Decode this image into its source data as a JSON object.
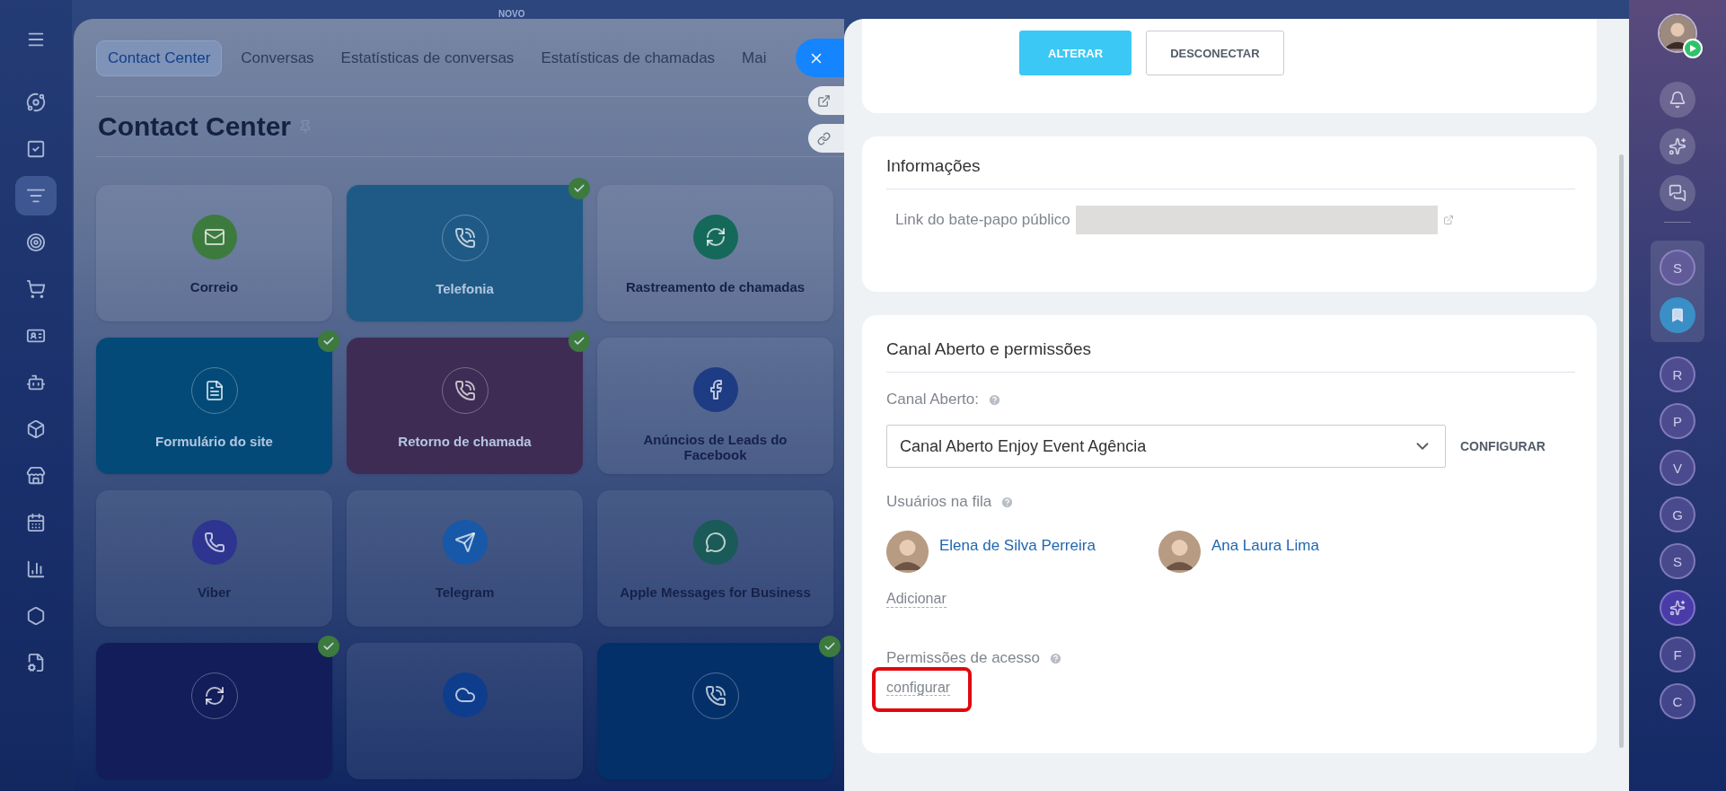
{
  "left_nav": {
    "items": [
      {
        "kind": "menu",
        "selected": false
      },
      {
        "kind": "flow",
        "selected": false
      },
      {
        "kind": "tasks",
        "selected": false
      },
      {
        "kind": "filter",
        "selected": true
      },
      {
        "kind": "target",
        "selected": false
      },
      {
        "kind": "cart",
        "selected": false
      },
      {
        "kind": "card",
        "selected": false
      },
      {
        "kind": "bot",
        "selected": false
      },
      {
        "kind": "box",
        "selected": false
      },
      {
        "kind": "store",
        "selected": false
      },
      {
        "kind": "calendar",
        "selected": false
      },
      {
        "kind": "chart",
        "selected": false
      },
      {
        "kind": "hexagon",
        "selected": false
      },
      {
        "kind": "doc",
        "selected": false
      }
    ]
  },
  "top_badge": "NOVO",
  "page": {
    "tabs": [
      {
        "label": "Contact Center",
        "selected": true
      },
      {
        "label": "Conversas",
        "selected": false
      },
      {
        "label": "Estatísticas de conversas",
        "selected": false
      },
      {
        "label": "Estatísticas de chamadas",
        "selected": false
      },
      {
        "label": "Mai",
        "selected": false
      }
    ],
    "title": "Contact Center",
    "cards": [
      {
        "label": "Correio",
        "kind": "mail",
        "connected": false,
        "color": "#3d7a3e"
      },
      {
        "label": "Telefonia",
        "kind": "phone",
        "connected": true,
        "color": "#1f5a86"
      },
      {
        "label": "Rastreamento de chamadas",
        "kind": "refresh",
        "connected": false,
        "color": "#14695a"
      },
      {
        "label": "Formulário do site",
        "kind": "form",
        "connected": true,
        "color": "#034a78"
      },
      {
        "label": "Retorno de chamada",
        "kind": "phone",
        "connected": true,
        "color": "#3e2c54"
      },
      {
        "label": "Anúncios de Leads do Facebook",
        "kind": "facebook",
        "connected": false,
        "color": "#1d3c84"
      },
      {
        "label": "Viber",
        "kind": "viber",
        "connected": false,
        "color": "#2d3590"
      },
      {
        "label": "Telegram",
        "kind": "send",
        "connected": false,
        "color": "#1858a8"
      },
      {
        "label": "Apple Messages for Business",
        "kind": "chat",
        "connected": false,
        "color": "#1a5a58"
      },
      {
        "kind": "refresh",
        "connected": true,
        "color": "#121d5a"
      },
      {
        "kind": "cloud",
        "connected": false,
        "color": "#0f3d8e"
      },
      {
        "kind": "phone",
        "connected": true,
        "color": "#04306a"
      }
    ]
  },
  "panel": {
    "actions": [
      {
        "label": "ALTERAR",
        "kind": "primary"
      },
      {
        "label": "DESCONECTAR",
        "kind": "secondary"
      }
    ],
    "info": {
      "title": "Informações",
      "link_label": "Link do bate-papo público"
    },
    "channel": {
      "title": "Canal Aberto e permissões",
      "open_channel_label": "Canal Aberto:",
      "select_value": "Canal Aberto Enjoy Event Agência",
      "configure": "CONFIGURAR",
      "queue_label": "Usuários na fila",
      "users": [
        {
          "name": "Elena de Silva Perreira"
        },
        {
          "name": "Ana Laura Lima"
        }
      ],
      "add": "Adicionar",
      "permissions_label": "Permissões de acesso",
      "permissions_link": "configurar"
    }
  },
  "right_bar": {
    "items": [
      {
        "kind": "avatar"
      },
      {
        "kind": "bell"
      },
      {
        "kind": "copilot"
      },
      {
        "kind": "chat"
      },
      {
        "kind": "letter",
        "text": "S",
        "pinned": true
      },
      {
        "kind": "bookmark",
        "pinned": true
      },
      {
        "kind": "letter",
        "text": "R",
        "pinned": false
      },
      {
        "kind": "letter",
        "text": "P",
        "pinned": false
      },
      {
        "kind": "letter",
        "text": "V",
        "pinned": false
      },
      {
        "kind": "letter",
        "text": "G",
        "pinned": false
      },
      {
        "kind": "letter",
        "text": "S",
        "pinned": false
      },
      {
        "kind": "copilot-round",
        "pinned": false
      },
      {
        "kind": "letter",
        "text": "F",
        "pinned": false
      },
      {
        "kind": "letter",
        "text": "C",
        "pinned": false
      }
    ]
  }
}
